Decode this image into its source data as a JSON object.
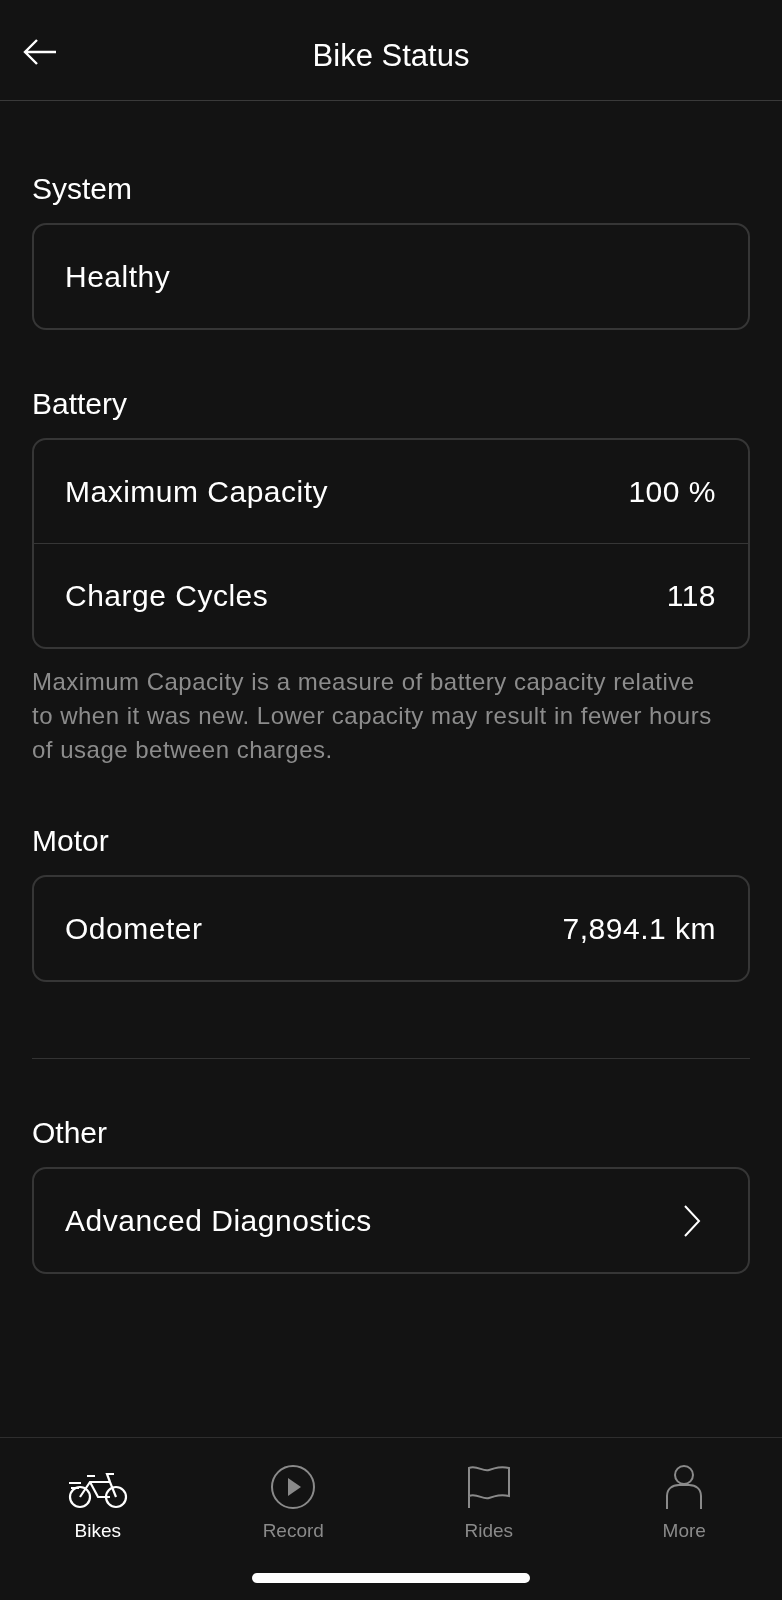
{
  "header": {
    "title": "Bike Status"
  },
  "sections": [
    {
      "title": "System",
      "rows": [
        {
          "label": "Healthy",
          "kind": "plain"
        }
      ]
    },
    {
      "title": "Battery",
      "rows": [
        {
          "label": "Maximum Capacity",
          "value": "100 %",
          "kind": "value"
        },
        {
          "label": "Charge Cycles",
          "value": "118",
          "kind": "value"
        }
      ],
      "note": "Maximum Capacity is a measure of battery capacity relative to when it was new. Lower capacity may result in fewer hours of usage between charges."
    },
    {
      "title": "Motor",
      "rows": [
        {
          "label": "Odometer",
          "value": "7,894.1 km",
          "kind": "value"
        }
      ]
    },
    {
      "title": "Other",
      "rows": [
        {
          "label": "Advanced Diagnostics",
          "kind": "link"
        }
      ]
    }
  ],
  "tabs": [
    {
      "label": "Bikes",
      "kind": "bike",
      "selected": true
    },
    {
      "label": "Record",
      "kind": "play",
      "selected": false
    },
    {
      "label": "Rides",
      "kind": "flag",
      "selected": false
    },
    {
      "label": "More",
      "kind": "person",
      "selected": false
    }
  ]
}
